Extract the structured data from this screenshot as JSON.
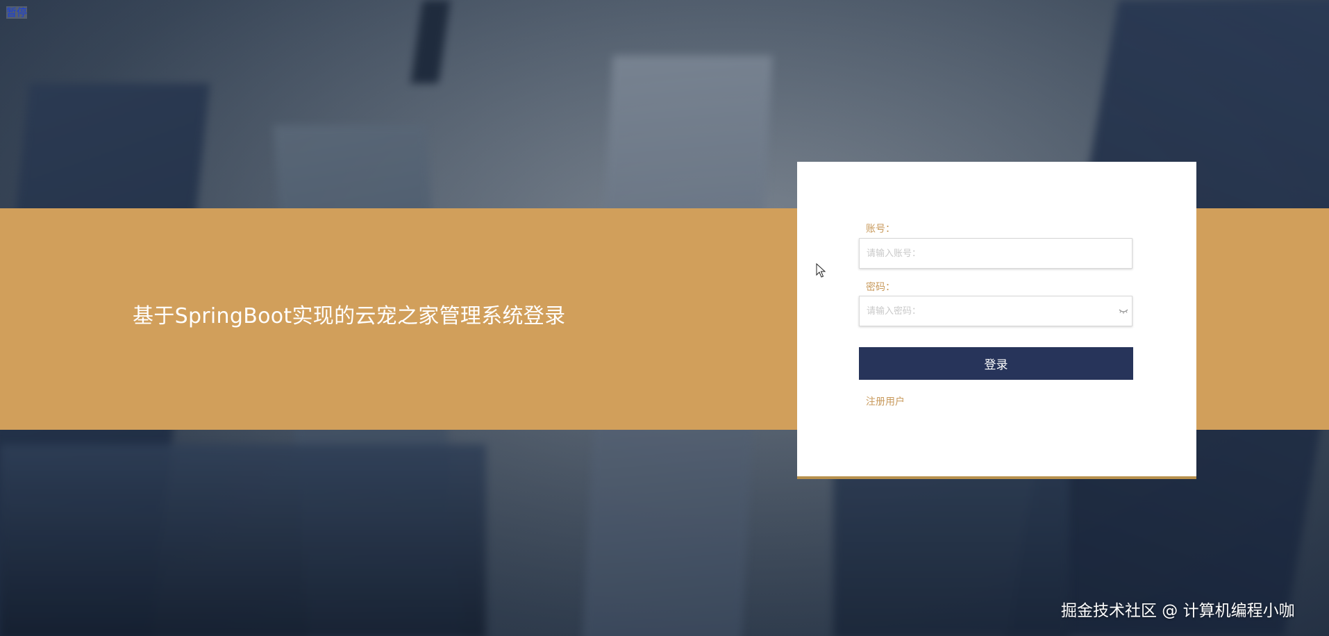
{
  "overlay": {
    "pause_label": "暂停",
    "watermark": "掘金技术社区 @ 计算机编程小咖"
  },
  "banner": {
    "title": "基于SpringBoot实现的云宠之家管理系统登录",
    "color": "#d19f5b"
  },
  "login": {
    "username_label": "账号：",
    "username_placeholder": "请输入账号：",
    "username_value": "",
    "password_label": "密码：",
    "password_placeholder": "请输入密码：",
    "password_value": "",
    "password_toggle_icon": "eye-closed-icon",
    "submit_label": "登录",
    "register_link": "注册用户",
    "button_color": "#27345a",
    "accent_color": "#c89a5c"
  }
}
